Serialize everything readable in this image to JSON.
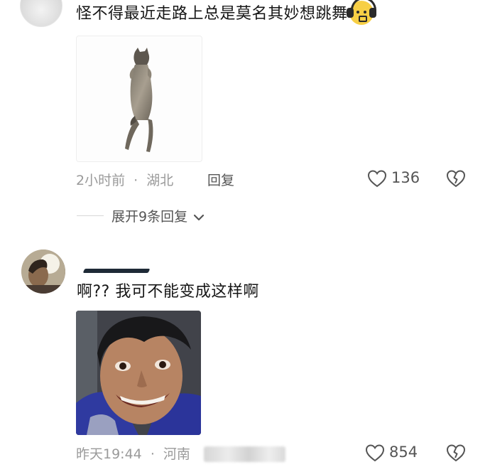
{
  "comments": [
    {
      "text": "怪不得最近走路上总是莫名其妙想跳舞",
      "emoji_icon": "headphone-face-emoji",
      "image_icon": "dancing-dog-image",
      "time": "2小时前",
      "separator": "·",
      "location": "湖北",
      "reply_label": "回复",
      "likes": "136",
      "expand_label": "展开9条回复"
    },
    {
      "text": "啊?? 我可不能变成这样啊",
      "image_icon": "smiling-man-image",
      "time": "昨天19:44",
      "separator": "·",
      "location": "河南",
      "likes": "854"
    }
  ]
}
